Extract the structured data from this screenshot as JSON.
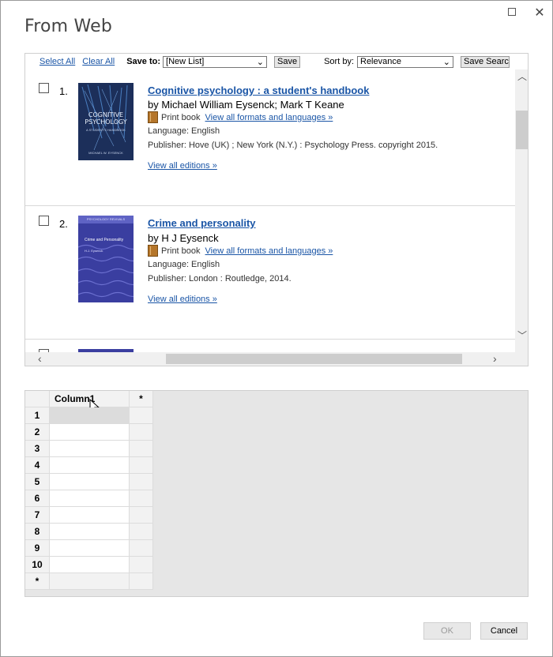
{
  "dialog": {
    "title": "From Web"
  },
  "toolbar": {
    "select_all": "Select All",
    "clear_all": "Clear All",
    "save_to_label": "Save to:",
    "save_to_value": "[New List]",
    "save_button": "Save",
    "sort_by_label": "Sort by:",
    "sort_by_value": "Relevance",
    "save_search_button": "Save Searc"
  },
  "results": [
    {
      "number": "1.",
      "title": "Cognitive psychology : a student's handbook",
      "author": "by Michael William Eysenck; Mark T Keane",
      "format": "Print book",
      "formats_link": "View all formats and languages »",
      "language": "Language: English",
      "publisher": "Publisher: Hove (UK) ; New York (N.Y.) : Psychology Press. copyright 2015.",
      "editions_link": "View all editions »",
      "cover": {
        "title": "COGNITIVE PSYCHOLOGY",
        "subtitle": "A STUDENT'S HANDBOOK",
        "authors": "MICHAEL W. EYSENCK",
        "color": "#1c2f5a"
      }
    },
    {
      "number": "2.",
      "title": "Crime and personality",
      "author": "by H J Eysenck",
      "format": "Print book",
      "formats_link": "View all formats and languages »",
      "language": "Language: English",
      "publisher": "Publisher: London : Routledge, 2014.",
      "editions_link": "View all editions »",
      "cover": {
        "series": "PSYCHOLOGY REVIVALS",
        "title": "Crime and Personality",
        "authors": "H.J. Eysenck",
        "color": "#3a3ea0"
      }
    }
  ],
  "grid": {
    "column_header": "Column1",
    "add_column": "*",
    "rows": [
      "1",
      "2",
      "3",
      "4",
      "5",
      "6",
      "7",
      "8",
      "9",
      "10"
    ],
    "new_row": "*"
  },
  "footer": {
    "ok": "OK",
    "cancel": "Cancel"
  },
  "colors": {
    "link": "#1a55a6",
    "grid_bg": "#e6e6e6"
  }
}
